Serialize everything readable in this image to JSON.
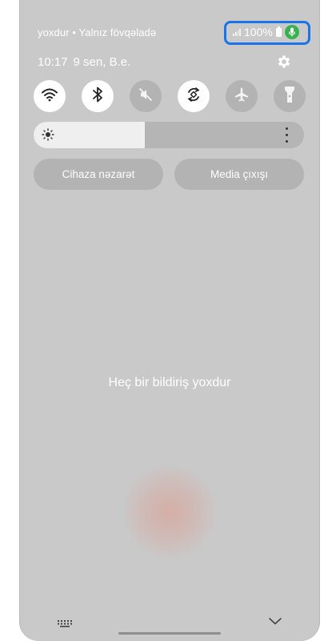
{
  "statusbar": {
    "carrier_text": "yoxdur • Yalnız fövqəladə",
    "battery_text": "100%",
    "icons": [
      "signal-icon",
      "battery-icon",
      "microphone-icon"
    ],
    "mic_color": "#37b24d",
    "highlight_color": "#1a73e8"
  },
  "header": {
    "time": "10:17",
    "date": "9 sen, B.e.",
    "settings_icon": "gear-icon"
  },
  "quick_toggles": [
    {
      "name": "wifi",
      "icon": "wifi-icon",
      "state": "on"
    },
    {
      "name": "bluetooth",
      "icon": "bluetooth-icon",
      "state": "on"
    },
    {
      "name": "sound",
      "icon": "mute-icon",
      "state": "off"
    },
    {
      "name": "auto-rotate",
      "icon": "rotate-icon",
      "state": "on"
    },
    {
      "name": "airplane",
      "icon": "airplane-icon",
      "state": "off"
    },
    {
      "name": "flashlight",
      "icon": "flashlight-icon",
      "state": "off"
    }
  ],
  "brightness": {
    "level": 0.41,
    "icons": [
      "sun-icon",
      "more-vertical-icon"
    ]
  },
  "buttons": {
    "device_control": "Cihaza nəzarət",
    "media_output": "Media çıxışı"
  },
  "notifications": {
    "empty_text": "Heç bir bildiriş yoxdur"
  },
  "footer": {
    "icons": [
      "keyboard-icon",
      "chevron-down-icon"
    ]
  }
}
